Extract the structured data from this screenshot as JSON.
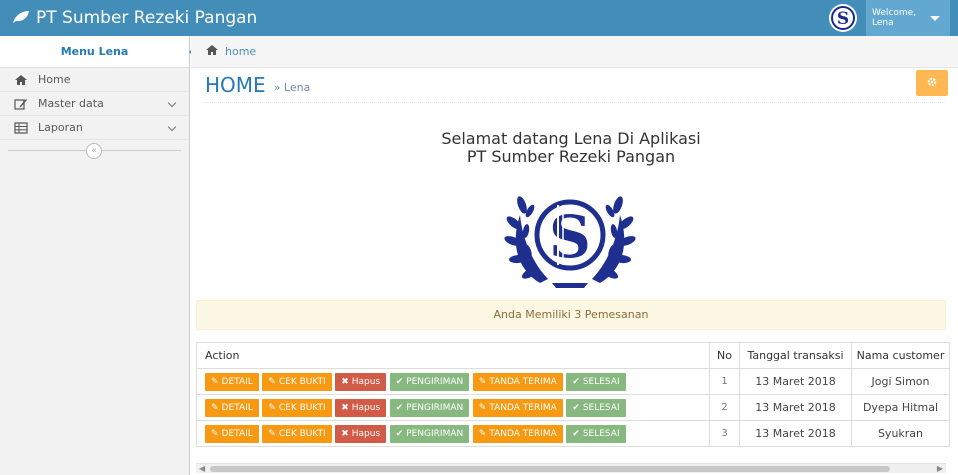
{
  "navbar": {
    "brand": "PT Sumber Rezeki Pangan",
    "welcome_line1": "Welcome,",
    "welcome_line2": "Lena"
  },
  "sidebar": {
    "header": "Menu Lena",
    "items": [
      {
        "label": "Home",
        "icon": "home-icon"
      },
      {
        "label": "Master data",
        "icon": "edit-icon"
      },
      {
        "label": "Laporan",
        "icon": "table-icon"
      }
    ],
    "collapse_symbol": "«"
  },
  "breadcrumb": {
    "home": "home"
  },
  "page": {
    "title": "HOME",
    "subtitle": "» Lena"
  },
  "welcome": {
    "line1": "Selamat datang Lena Di Aplikasi",
    "line2": "PT Sumber Rezeki Pangan"
  },
  "alert": "Anda Memiliki 3 Pemesanan",
  "table": {
    "headers": [
      "Action",
      "No",
      "Tanggal transaksi",
      "Nama customer"
    ],
    "buttons": {
      "detail": "DETAIL",
      "cek_bukti": "CEK BUKTI",
      "hapus": "Hapus",
      "pengiriman": "PENGIRIMAN",
      "tanda_terima": "TANDA TERIMA",
      "selesai": "SELESAI"
    },
    "rows": [
      {
        "no": "1",
        "date": "13 Maret 2018",
        "customer": "Jogi Simon"
      },
      {
        "no": "2",
        "date": "13 Maret 2018",
        "customer": "Dyepa Hitmal"
      },
      {
        "no": "3",
        "date": "13 Maret 2018",
        "customer": "Syukran"
      }
    ]
  },
  "colors": {
    "navbar": "#438eb9",
    "warning": "#f89406",
    "danger": "#d15b47",
    "success": "#87b87f",
    "settings": "#ffb752"
  }
}
